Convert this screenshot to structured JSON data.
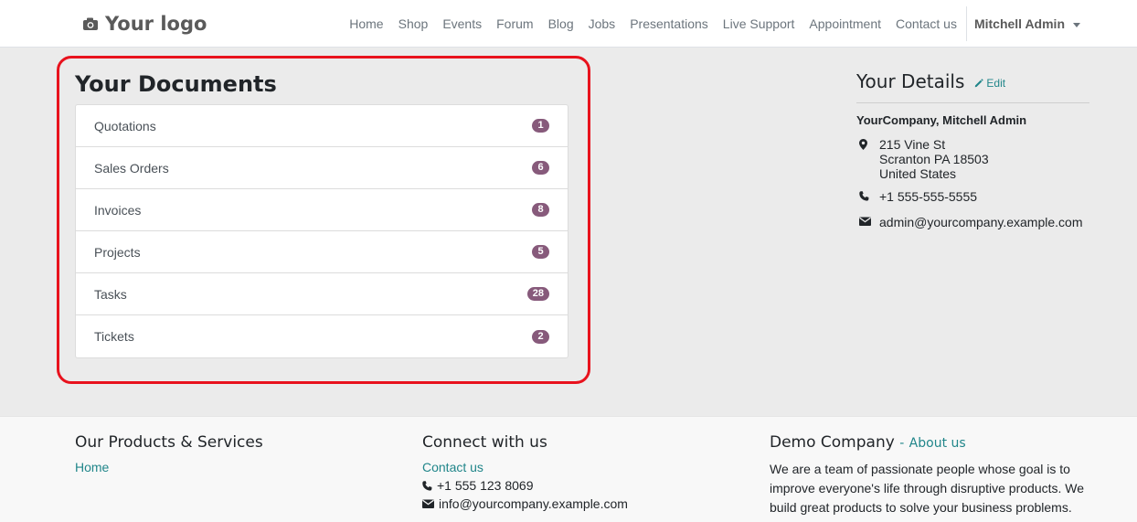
{
  "navbar": {
    "logo_text": "Your logo",
    "menu": [
      "Home",
      "Shop",
      "Events",
      "Forum",
      "Blog",
      "Jobs",
      "Presentations",
      "Live Support",
      "Appointment",
      "Contact us"
    ],
    "user": "Mitchell Admin"
  },
  "documents": {
    "title": "Your Documents",
    "items": [
      {
        "label": "Quotations",
        "count": "1"
      },
      {
        "label": "Sales Orders",
        "count": "6"
      },
      {
        "label": "Invoices",
        "count": "8"
      },
      {
        "label": "Projects",
        "count": "5"
      },
      {
        "label": "Tasks",
        "count": "28"
      },
      {
        "label": "Tickets",
        "count": "2"
      }
    ]
  },
  "details": {
    "title": "Your Details",
    "edit_label": "Edit",
    "company": "YourCompany, Mitchell Admin",
    "address": [
      "215 Vine St",
      "Scranton PA 18503",
      "United States"
    ],
    "phone": "+1 555-555-5555",
    "email": "admin@yourcompany.example.com"
  },
  "footer": {
    "products": {
      "title": "Our Products & Services",
      "link": "Home"
    },
    "connect": {
      "title": "Connect with us",
      "link": "Contact us",
      "phone": "+1 555 123 8069",
      "email": "info@yourcompany.example.com"
    },
    "company": {
      "title": "Demo Company",
      "separator": "-",
      "about": "About us",
      "text": "We are a team of passionate people whose goal is to improve everyone's life through disruptive products. We build great products to solve your business problems."
    }
  },
  "colors": {
    "accent": "#21868a",
    "badge": "#875a7b",
    "highlight": "#e8121d"
  }
}
